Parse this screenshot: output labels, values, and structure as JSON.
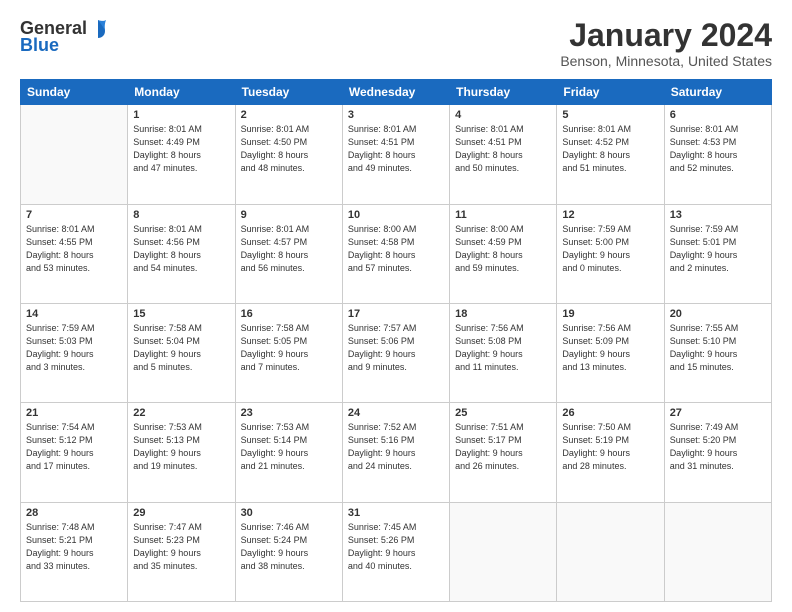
{
  "header": {
    "logo_general": "General",
    "logo_blue": "Blue",
    "month_title": "January 2024",
    "location": "Benson, Minnesota, United States"
  },
  "days_of_week": [
    "Sunday",
    "Monday",
    "Tuesday",
    "Wednesday",
    "Thursday",
    "Friday",
    "Saturday"
  ],
  "weeks": [
    [
      {
        "num": "",
        "info": ""
      },
      {
        "num": "1",
        "info": "Sunrise: 8:01 AM\nSunset: 4:49 PM\nDaylight: 8 hours\nand 47 minutes."
      },
      {
        "num": "2",
        "info": "Sunrise: 8:01 AM\nSunset: 4:50 PM\nDaylight: 8 hours\nand 48 minutes."
      },
      {
        "num": "3",
        "info": "Sunrise: 8:01 AM\nSunset: 4:51 PM\nDaylight: 8 hours\nand 49 minutes."
      },
      {
        "num": "4",
        "info": "Sunrise: 8:01 AM\nSunset: 4:51 PM\nDaylight: 8 hours\nand 50 minutes."
      },
      {
        "num": "5",
        "info": "Sunrise: 8:01 AM\nSunset: 4:52 PM\nDaylight: 8 hours\nand 51 minutes."
      },
      {
        "num": "6",
        "info": "Sunrise: 8:01 AM\nSunset: 4:53 PM\nDaylight: 8 hours\nand 52 minutes."
      }
    ],
    [
      {
        "num": "7",
        "info": "Sunrise: 8:01 AM\nSunset: 4:55 PM\nDaylight: 8 hours\nand 53 minutes."
      },
      {
        "num": "8",
        "info": "Sunrise: 8:01 AM\nSunset: 4:56 PM\nDaylight: 8 hours\nand 54 minutes."
      },
      {
        "num": "9",
        "info": "Sunrise: 8:01 AM\nSunset: 4:57 PM\nDaylight: 8 hours\nand 56 minutes."
      },
      {
        "num": "10",
        "info": "Sunrise: 8:00 AM\nSunset: 4:58 PM\nDaylight: 8 hours\nand 57 minutes."
      },
      {
        "num": "11",
        "info": "Sunrise: 8:00 AM\nSunset: 4:59 PM\nDaylight: 8 hours\nand 59 minutes."
      },
      {
        "num": "12",
        "info": "Sunrise: 7:59 AM\nSunset: 5:00 PM\nDaylight: 9 hours\nand 0 minutes."
      },
      {
        "num": "13",
        "info": "Sunrise: 7:59 AM\nSunset: 5:01 PM\nDaylight: 9 hours\nand 2 minutes."
      }
    ],
    [
      {
        "num": "14",
        "info": "Sunrise: 7:59 AM\nSunset: 5:03 PM\nDaylight: 9 hours\nand 3 minutes."
      },
      {
        "num": "15",
        "info": "Sunrise: 7:58 AM\nSunset: 5:04 PM\nDaylight: 9 hours\nand 5 minutes."
      },
      {
        "num": "16",
        "info": "Sunrise: 7:58 AM\nSunset: 5:05 PM\nDaylight: 9 hours\nand 7 minutes."
      },
      {
        "num": "17",
        "info": "Sunrise: 7:57 AM\nSunset: 5:06 PM\nDaylight: 9 hours\nand 9 minutes."
      },
      {
        "num": "18",
        "info": "Sunrise: 7:56 AM\nSunset: 5:08 PM\nDaylight: 9 hours\nand 11 minutes."
      },
      {
        "num": "19",
        "info": "Sunrise: 7:56 AM\nSunset: 5:09 PM\nDaylight: 9 hours\nand 13 minutes."
      },
      {
        "num": "20",
        "info": "Sunrise: 7:55 AM\nSunset: 5:10 PM\nDaylight: 9 hours\nand 15 minutes."
      }
    ],
    [
      {
        "num": "21",
        "info": "Sunrise: 7:54 AM\nSunset: 5:12 PM\nDaylight: 9 hours\nand 17 minutes."
      },
      {
        "num": "22",
        "info": "Sunrise: 7:53 AM\nSunset: 5:13 PM\nDaylight: 9 hours\nand 19 minutes."
      },
      {
        "num": "23",
        "info": "Sunrise: 7:53 AM\nSunset: 5:14 PM\nDaylight: 9 hours\nand 21 minutes."
      },
      {
        "num": "24",
        "info": "Sunrise: 7:52 AM\nSunset: 5:16 PM\nDaylight: 9 hours\nand 24 minutes."
      },
      {
        "num": "25",
        "info": "Sunrise: 7:51 AM\nSunset: 5:17 PM\nDaylight: 9 hours\nand 26 minutes."
      },
      {
        "num": "26",
        "info": "Sunrise: 7:50 AM\nSunset: 5:19 PM\nDaylight: 9 hours\nand 28 minutes."
      },
      {
        "num": "27",
        "info": "Sunrise: 7:49 AM\nSunset: 5:20 PM\nDaylight: 9 hours\nand 31 minutes."
      }
    ],
    [
      {
        "num": "28",
        "info": "Sunrise: 7:48 AM\nSunset: 5:21 PM\nDaylight: 9 hours\nand 33 minutes."
      },
      {
        "num": "29",
        "info": "Sunrise: 7:47 AM\nSunset: 5:23 PM\nDaylight: 9 hours\nand 35 minutes."
      },
      {
        "num": "30",
        "info": "Sunrise: 7:46 AM\nSunset: 5:24 PM\nDaylight: 9 hours\nand 38 minutes."
      },
      {
        "num": "31",
        "info": "Sunrise: 7:45 AM\nSunset: 5:26 PM\nDaylight: 9 hours\nand 40 minutes."
      },
      {
        "num": "",
        "info": ""
      },
      {
        "num": "",
        "info": ""
      },
      {
        "num": "",
        "info": ""
      }
    ]
  ]
}
